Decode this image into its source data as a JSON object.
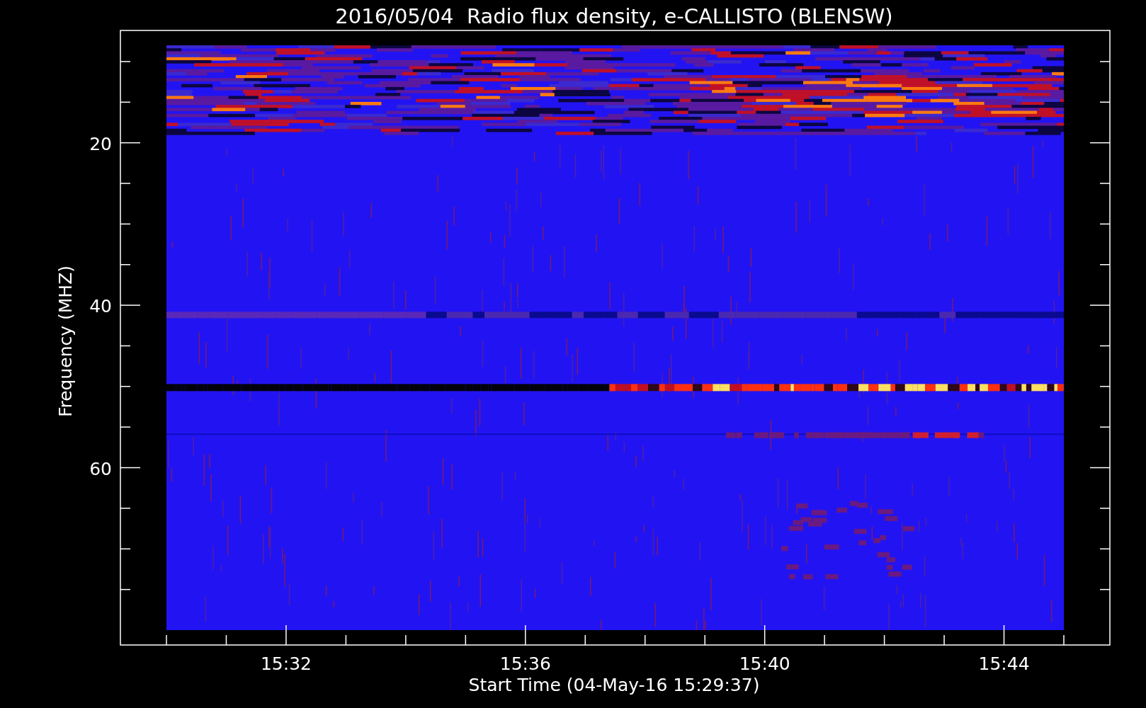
{
  "title": "2016/05/04  Radio flux density, e-CALLISTO (BLENSW)",
  "x_axis": {
    "label": "Start Time (04-May-16 15:29:37)",
    "ticks": [
      "15:32",
      "15:36",
      "15:40",
      "15:44"
    ]
  },
  "y_axis": {
    "label": "Frequency (MHZ)",
    "ticks": [
      "20",
      "40",
      "60"
    ]
  }
}
